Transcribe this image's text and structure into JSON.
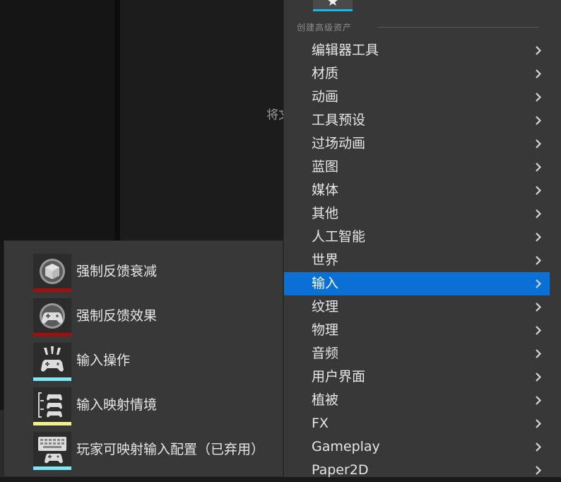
{
  "colors": {
    "menu_bg": "#383838",
    "highlight": "#0a70d6",
    "bar_red": "#a10f0f",
    "bar_cyan": "#7fe8f0",
    "bar_yellow": "#f3f08a",
    "top_icon_bar": "#19b7e8"
  },
  "center_hint": "将文",
  "menu": {
    "section_header": "创建高级资产",
    "items": [
      {
        "label": "编辑器工具"
      },
      {
        "label": "材质"
      },
      {
        "label": "动画"
      },
      {
        "label": "工具预设"
      },
      {
        "label": "过场动画"
      },
      {
        "label": "蓝图"
      },
      {
        "label": "媒体"
      },
      {
        "label": "其他"
      },
      {
        "label": "人工智能"
      },
      {
        "label": "世界"
      },
      {
        "label": "输入",
        "active": true
      },
      {
        "label": "纹理"
      },
      {
        "label": "物理"
      },
      {
        "label": "音频"
      },
      {
        "label": "用户界面"
      },
      {
        "label": "植被"
      },
      {
        "label": "FX"
      },
      {
        "label": "Gameplay"
      },
      {
        "label": "Paper2D"
      }
    ]
  },
  "submenu": {
    "items": [
      {
        "label": "强制反馈衰减",
        "icon": "cube-icon",
        "bar": "#a10f0f"
      },
      {
        "label": "强制反馈效果",
        "icon": "gamepad-rumble-icon",
        "bar": "#a10f0f"
      },
      {
        "label": "输入操作",
        "icon": "gamepad-action-icon",
        "bar": "#7fe8f0"
      },
      {
        "label": "输入映射情境",
        "icon": "gamepad-stack-icon",
        "bar": "#f3f08a"
      },
      {
        "label": "玩家可映射输入配置（已弃用）",
        "icon": "keyboard-gamepad-icon",
        "bar": "#7fe8f0"
      }
    ]
  }
}
